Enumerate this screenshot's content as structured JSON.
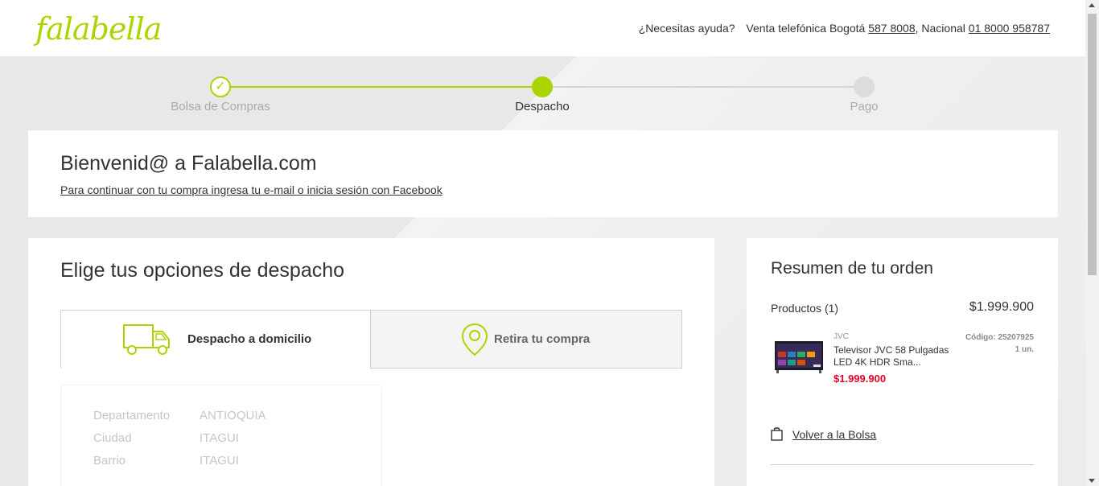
{
  "header": {
    "logo_text": "falabella",
    "help_question": "¿Necesitas ayuda?",
    "phone_prefix": "Venta telefónica Bogotá",
    "phone_bogota": "587 8008",
    "national_prefix": ", Nacional",
    "phone_national": "01 8000 958787"
  },
  "stepper": {
    "steps": [
      {
        "label": "Bolsa de Compras",
        "state": "done"
      },
      {
        "label": "Despacho",
        "state": "current"
      },
      {
        "label": "Pago",
        "state": "pending"
      }
    ],
    "accent_color": "#aad500",
    "check_glyph": "✓"
  },
  "welcome": {
    "title": "Bienvenid@ a Falabella.com",
    "login_link": "Para continuar con tu compra ingresa tu e-mail o inicia sesión con Facebook"
  },
  "shipping": {
    "title": "Elige tus opciones de despacho",
    "tabs": [
      {
        "label": "Despacho a domicilio",
        "icon": "truck-icon",
        "active": true
      },
      {
        "label": "Retira tu compra",
        "icon": "location-pin-icon",
        "active": false
      }
    ],
    "address": [
      {
        "key": "Departamento",
        "value": "ANTIOQUIA"
      },
      {
        "key": "Ciudad",
        "value": "ITAGUI"
      },
      {
        "key": "Barrio",
        "value": "ITAGUI"
      }
    ]
  },
  "summary": {
    "title": "Resumen de tu orden",
    "products_label": "Productos",
    "products_count": "(1)",
    "products_total": "$1.999.900",
    "item": {
      "brand": "JVC",
      "name": "Televisor JVC 58 Pulgadas LED 4K HDR Sma...",
      "price": "$1.999.900",
      "code": "Código: 25207925",
      "qty": "1 un."
    },
    "back_link": "Volver a la Bolsa",
    "price_color": "#e4002b"
  }
}
